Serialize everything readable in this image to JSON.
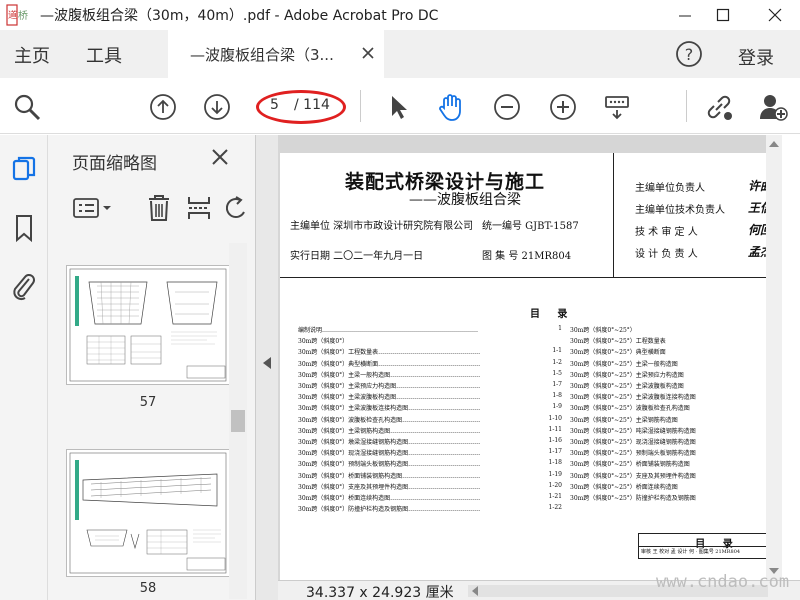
{
  "window": {
    "title": "—波腹板组合梁（30m，40m）.pdf - Adobe Acrobat Pro DC",
    "logo_text": "道 桥 网"
  },
  "nav": {
    "home_label": "主页",
    "tools_label": "工具",
    "doc_tab_label": "—波腹板组合梁（3...",
    "login_label": "登录"
  },
  "toolbar": {
    "current_page": "5",
    "total_pages": "/ 114"
  },
  "thumbnails": {
    "title": "页面缩略图",
    "pages": [
      {
        "number": "57"
      },
      {
        "number": "58"
      }
    ]
  },
  "document": {
    "main_title": "装配式桥梁设计与施工",
    "subtitle": "——波腹板组合梁",
    "org_line": "主编单位  深圳市市政设计研究院有限公司",
    "code_line": "统一编号  GJBT-1587",
    "date_line": "实行日期  二〇二一年九月一日",
    "atlas_line": "图 集 号  21MR804",
    "signers": [
      {
        "role": "主编单位负责人",
        "sign": "许曲"
      },
      {
        "role": "主编单位技术负责人",
        "sign": "王信"
      },
      {
        "role": "技 术 审 定 人",
        "sign": "何回"
      },
      {
        "role": "设 计 负 责 人",
        "sign": "孟杰"
      }
    ],
    "toc_title": "目     录",
    "toc_left": [
      {
        "text": "编制说明……………………………………………………………………",
        "page": "1"
      },
      {
        "text": "30m跨（斜度0°）",
        "page": ""
      },
      {
        "text": "30m跨（斜度0°）工程数量表……………………………………………",
        "page": "1-1"
      },
      {
        "text": "30m跨（斜度0°）典型横断面……………………………………………",
        "page": "1-2"
      },
      {
        "text": "30m跨（斜度0°）主梁一般构造图………………………………………",
        "page": "1-5"
      },
      {
        "text": "30m跨（斜度0°）主梁预应力构造图……………………………………",
        "page": "1-7"
      },
      {
        "text": "30m跨（斜度0°）主梁波腹板构造图……………………………………",
        "page": "1-8"
      },
      {
        "text": "30m跨（斜度0°）主梁波腹板连接构造图………………………………",
        "page": "1-9"
      },
      {
        "text": "30m跨（斜度0°）波腹板检查孔构造图…………………………………",
        "page": "1-10"
      },
      {
        "text": "30m跨（斜度0°）主梁钢筋构造图………………………………………",
        "page": "1-11"
      },
      {
        "text": "30m跨（斜度0°）墩梁湿接缝钢筋构造图………………………………",
        "page": "1-16"
      },
      {
        "text": "30m跨（斜度0°）现浇湿接缝钢筋构造图………………………………",
        "page": "1-17"
      },
      {
        "text": "30m跨（斜度0°）预制端头板钢筋构造图………………………………",
        "page": "1-18"
      },
      {
        "text": "30m跨（斜度0°）桥面铺装钢筋构造图…………………………………",
        "page": "1-19"
      },
      {
        "text": "30m跨（斜度0°）支座及其预埋件构造图………………………………",
        "page": "1-20"
      },
      {
        "text": "30m跨（斜度0°）桥面连续构造图………………………………………",
        "page": "1-21"
      },
      {
        "text": "30m跨（斜度0°）防撞护栏构造及钢筋图………………………………",
        "page": "1-22"
      }
    ],
    "toc_right": [
      "30m跨（斜度0°~25°）",
      "30m跨（斜度0°~25°）工程数量表",
      "30m跨（斜度0°~25°）典型横断面",
      "30m跨（斜度0°~25°）主梁一般构造图",
      "30m跨（斜度0°~25°）主梁预应力构造图",
      "30m跨（斜度0°~25°）主梁波腹板构造图",
      "30m跨（斜度0°~25°）主梁波腹板连接构造图",
      "30m跨（斜度0°~25°）波腹板检查孔构造图",
      "30m跨（斜度0°~25°）主梁钢筋构造图",
      "30m跨（斜度0°~25°）吨梁湿接缝钢筋构造图",
      "30m跨（斜度0°~25°）现浇湿接缝钢筋构造图",
      "30m跨（斜度0°~25°）预制端头板钢筋构造图",
      "30m跨（斜度0°~25°）桥面铺装钢筋构造图",
      "30m跨（斜度0°~25°）支座及其预埋件构造图",
      "30m跨（斜度0°~25°）桥面连续构造图",
      "30m跨（斜度0°~25°）防撞护栏构造及钢筋图"
    ],
    "stamp_title": "目     录",
    "stamp_row": "审核 王   校对 孟   设计 何 · 图集号 21MR804"
  },
  "status": {
    "dimensions": "34.337 x 24.923 厘米"
  },
  "watermark": "www.cndao.com",
  "colors": {
    "accent_blue": "#1473e6",
    "annotation_red": "#e02020"
  }
}
